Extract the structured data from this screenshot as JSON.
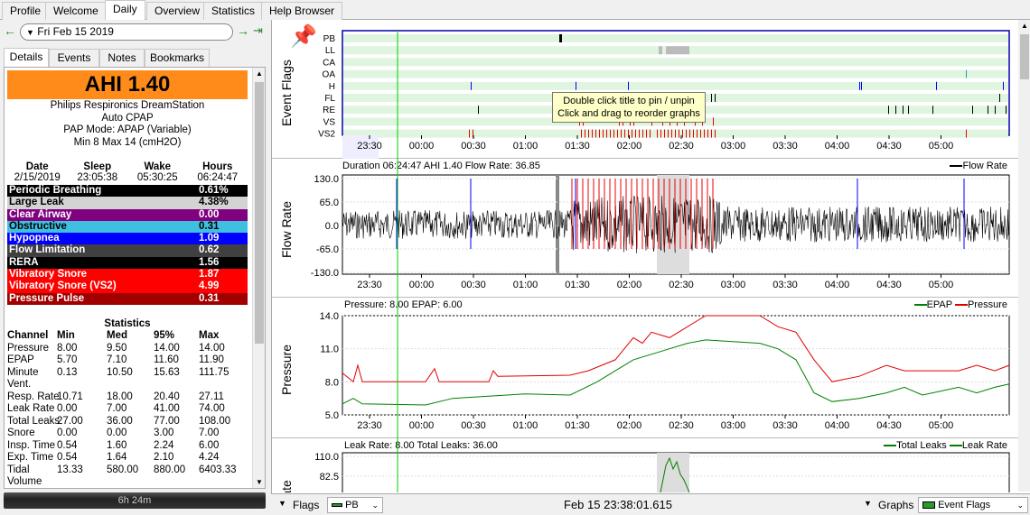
{
  "tabs": [
    {
      "label": "Profile"
    },
    {
      "label": "Welcome"
    },
    {
      "label": "Daily"
    },
    {
      "label": "Overview"
    },
    {
      "label": "Statistics"
    },
    {
      "label": "Help Browser"
    }
  ],
  "date": {
    "value": "Fri Feb 15 2019"
  },
  "subtabs": [
    {
      "label": "Details"
    },
    {
      "label": "Events"
    },
    {
      "label": "Notes"
    },
    {
      "label": "Bookmarks"
    }
  ],
  "summary": {
    "ahi": "AHI 1.40",
    "machine": [
      "Philips Respironics DreamStation",
      "Auto CPAP",
      "PAP Mode: APAP (Variable)",
      "Min 8 Max 14 (cmH2O)"
    ],
    "headers": [
      "Date",
      "Sleep",
      "Wake",
      "Hours"
    ],
    "values": [
      "2/15/2019",
      "23:05:38",
      "05:30:25",
      "06:24:47"
    ]
  },
  "indices": [
    {
      "label": "Periodic Breathing",
      "value": "0.61%",
      "bg": "#000000",
      "fg": "#ffffff"
    },
    {
      "label": "Large Leak",
      "value": "4.38%",
      "bg": "#d3d3d3",
      "fg": "#000000"
    },
    {
      "label": "Clear Airway",
      "value": "0.00",
      "bg": "#800080",
      "fg": "#ffffff"
    },
    {
      "label": "Obstructive",
      "value": "0.31",
      "bg": "#40c0e0",
      "fg": "#000000"
    },
    {
      "label": "Hypopnea",
      "value": "1.09",
      "bg": "#0000ff",
      "fg": "#ffffff"
    },
    {
      "label": "Flow Limitation",
      "value": "0.62",
      "bg": "#404040",
      "fg": "#ffffff"
    },
    {
      "label": "RERA",
      "value": "1.56",
      "bg": "#000000",
      "fg": "#ffffff"
    },
    {
      "label": "Vibratory Snore",
      "value": "1.87",
      "bg": "#ff0000",
      "fg": "#ffffff"
    },
    {
      "label": "Vibratory Snore (VS2)",
      "value": "4.99",
      "bg": "#ff0000",
      "fg": "#ffffff"
    },
    {
      "label": "Pressure Pulse",
      "value": "0.31",
      "bg": "#a00000",
      "fg": "#ffffff"
    }
  ],
  "stats": {
    "title": "Statistics",
    "headers": [
      "Channel",
      "Min",
      "Med",
      "95%",
      "Max"
    ],
    "rows": [
      [
        "Pressure",
        "8.00",
        "9.50",
        "14.00",
        "14.00"
      ],
      [
        "EPAP",
        "5.70",
        "7.10",
        "11.60",
        "11.90"
      ],
      [
        "Minute",
        "0.13",
        "10.50",
        "15.63",
        "111.75"
      ],
      [
        "Vent.",
        "",
        "",
        "",
        ""
      ],
      [
        "Resp. Rate",
        "10.71",
        "18.00",
        "20.40",
        "27.11"
      ],
      [
        "Leak Rate",
        "0.00",
        "7.00",
        "41.00",
        "74.00"
      ],
      [
        "Total Leaks",
        "27.00",
        "36.00",
        "77.00",
        "108.00"
      ],
      [
        "Snore",
        "0.00",
        "0.00",
        "3.00",
        "7.00"
      ],
      [
        "Insp. Time",
        "0.54",
        "1.60",
        "2.24",
        "6.00"
      ],
      [
        "Exp. Time",
        "0.54",
        "1.64",
        "2.10",
        "4.24"
      ],
      [
        "Tidal",
        "13.33",
        "580.00",
        "880.00",
        "6403.33"
      ],
      [
        "Volume",
        "",
        "",
        "",
        ""
      ]
    ]
  },
  "sleep_bar": "6h 24m",
  "tooltip": [
    "Double click title to pin / unpin",
    "Click and drag to reorder graphs"
  ],
  "event_flags": {
    "ylabel": "Event Flags",
    "channels": [
      "PB",
      "LL",
      "CA",
      "OA",
      "H",
      "FL",
      "RE",
      "VS",
      "VS2"
    ]
  },
  "time_ticks": [
    "23:30",
    "00:00",
    "00:30",
    "01:00",
    "01:30",
    "02:00",
    "02:30",
    "03:00",
    "03:30",
    "04:00",
    "04:30",
    "05:00"
  ],
  "flow": {
    "title": "Duration 06:24:47 AHI 1.40 Flow Rate: 36.85",
    "ylabel": "Flow Rate",
    "legend": "Flow Rate",
    "yticks": [
      "130.0",
      "65.0",
      "0.0",
      "-65.0",
      "-130.0"
    ]
  },
  "pressure": {
    "title": "Pressure: 8.00 EPAP: 6.00",
    "ylabel": "Pressure",
    "legend": [
      "EPAP",
      "Pressure"
    ],
    "yticks": [
      "14.0",
      "11.0",
      "8.0",
      "5.0"
    ],
    "pressure_color": "#e00000",
    "epap_color": "#008000"
  },
  "leak": {
    "title": "Leak Rate: 8.00 Total Leaks: 36.00",
    "ylabel": "Leak Rate",
    "legend": [
      "Total Leaks",
      "Leak Rate"
    ],
    "yticks": [
      "110.0",
      "82.5"
    ]
  },
  "status": {
    "flags_label": "Flags",
    "flags_select": "PB",
    "time": "Feb 15 23:38:01.615",
    "graphs_label": "Graphs",
    "graphs_select": "Event Flags"
  }
}
